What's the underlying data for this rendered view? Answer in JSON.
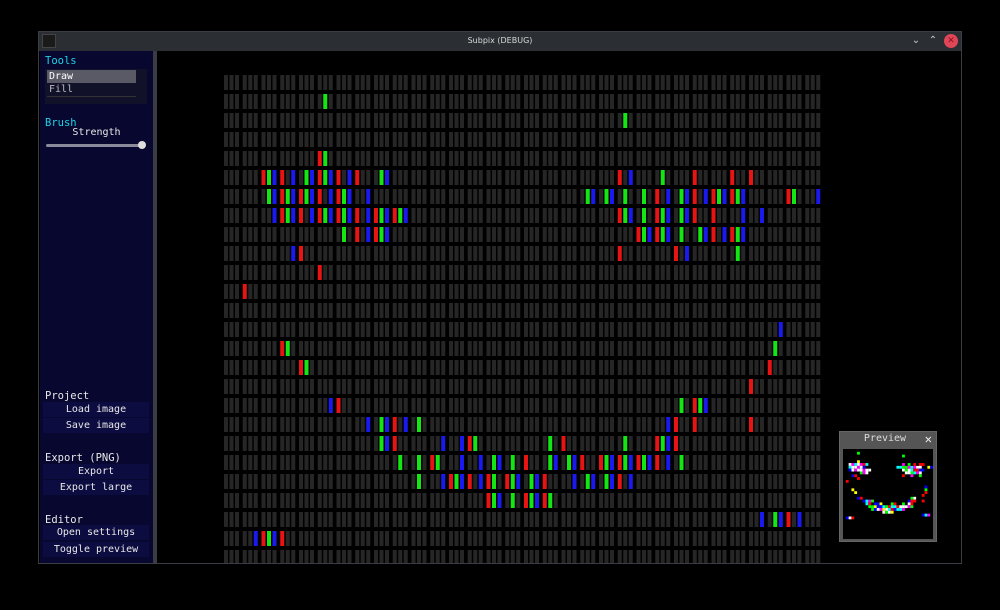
{
  "window": {
    "title": "Subpix (DEBUG)",
    "minimize_icon": "chevron-down",
    "maximize_icon": "chevron-up",
    "close_icon": "close"
  },
  "sidebar": {
    "tools_heading": "Tools",
    "tools": [
      {
        "label": "Draw",
        "selected": true
      },
      {
        "label": "Fill",
        "selected": false
      }
    ],
    "brush_heading": "Brush",
    "strength_label": "Strength",
    "strength_value": 1.0,
    "project_heading": "Project",
    "load_image": "Load image",
    "save_image": "Save image",
    "export_heading": "Export (PNG)",
    "export": "Export",
    "export_large": "Export large",
    "editor_heading": "Editor",
    "open_settings": "Open settings",
    "toggle_preview": "Toggle preview"
  },
  "colors": {
    "accent": "#1fd3e6",
    "sidebar_bg": "#07072f",
    "off": "#262626",
    "red": "#e81414",
    "green": "#14e614",
    "blue": "#1a1aee"
  },
  "canvas": {
    "image_width": 32,
    "lit_subpixels": [
      [],
      [
        16
      ],
      [
        64
      ],
      [],
      [
        15,
        16
      ],
      [
        6,
        7,
        8,
        9,
        11,
        13,
        14,
        15,
        16,
        17,
        18,
        20,
        21,
        25,
        26,
        63,
        65,
        70,
        75,
        81,
        84
      ],
      [
        7,
        8,
        9,
        10,
        11,
        12,
        13,
        14,
        15,
        17,
        18,
        19,
        20,
        23,
        58,
        59,
        61,
        62,
        64,
        67,
        69,
        71,
        73,
        74,
        75,
        77,
        78,
        79,
        80,
        81,
        82,
        83,
        90,
        91,
        95
      ],
      [
        8,
        9,
        10,
        11,
        12,
        14,
        15,
        16,
        17,
        18,
        19,
        20,
        21,
        23,
        24,
        25,
        26,
        27,
        28,
        29,
        63,
        64,
        65,
        67,
        69,
        70,
        71,
        73,
        74,
        75,
        78,
        83,
        86
      ],
      [
        19,
        21,
        23,
        24,
        25,
        26,
        66,
        67,
        68,
        69,
        70,
        71,
        73,
        76,
        77,
        78,
        80,
        81,
        82,
        83
      ],
      [
        11,
        12,
        63,
        72,
        74,
        82
      ],
      [
        15
      ],
      [
        3
      ],
      [],
      [
        89
      ],
      [
        9,
        10,
        88
      ],
      [
        12,
        13,
        87
      ],
      [
        84
      ],
      [
        17,
        18,
        73,
        75,
        76,
        77
      ],
      [
        23,
        25,
        26,
        27,
        29,
        31,
        71,
        72,
        75,
        84
      ],
      [
        25,
        26,
        27,
        35,
        38,
        39,
        40,
        52,
        54,
        64,
        69,
        70,
        71,
        72
      ],
      [
        28,
        31,
        33,
        34,
        38,
        41,
        43,
        44,
        46,
        48,
        52,
        53,
        55,
        56,
        57,
        60,
        61,
        62,
        63,
        64,
        65,
        66,
        67,
        68,
        69,
        71,
        73
      ],
      [
        31,
        35,
        36,
        37,
        38,
        39,
        41,
        42,
        43,
        45,
        46,
        47,
        49,
        50,
        51,
        56,
        58,
        59,
        61,
        62,
        63,
        65
      ],
      [
        42,
        43,
        44,
        46,
        48,
        49,
        50,
        51,
        52
      ],
      [
        86,
        88,
        89,
        90,
        92
      ],
      [
        5,
        6,
        7,
        8,
        9
      ],
      []
    ]
  },
  "preview": {
    "title": "Preview",
    "close_icon": "close"
  }
}
